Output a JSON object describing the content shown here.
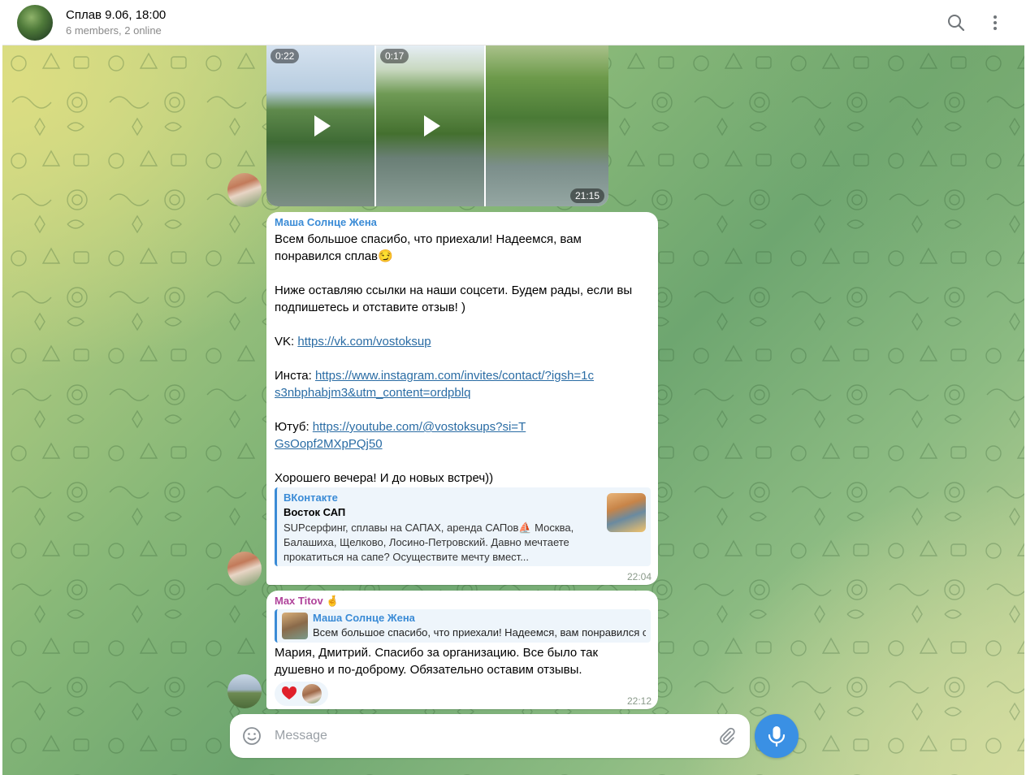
{
  "header": {
    "title": "Сплав 9.06, 18:00",
    "subtitle": "6 members, 2 online",
    "search_icon": "search-icon",
    "menu_icon": "more-vertical-icon"
  },
  "media_group": {
    "videos": [
      {
        "duration": "0:22"
      },
      {
        "duration": "0:17"
      }
    ],
    "time": "21:15"
  },
  "message1": {
    "sender": "Маша Солнце Жена",
    "sender_color": "#3a8bd6",
    "line1": "Всем большое спасибо, что приехали! Надеемся, вам понравился сплав😏",
    "line2": "Ниже оставляю ссылки на наши соцсети. Будем рады, если вы подпишетесь и отставите отзыв! )",
    "vk_label": "VK: ",
    "vk_link": "https://vk.com/vostoksup",
    "insta_label": "Инста: ",
    "insta_link": "https://www.instagram.com/invites/contact/?igsh=1cs3nbphabjm3&utm_content=ordpblq",
    "yt_label": "Ютуб: ",
    "yt_link": "https://youtube.com/@vostoksups?si=TGsOopf2MXpPQj50",
    "closing": "Хорошего вечера! И до новых встреч))",
    "preview": {
      "site": "ВКонтакте",
      "title": "Восток САП",
      "description": "SUPсерфинг, сплавы на САПАХ, аренда САПов⛵ Москва, Балашиха, Щелково, Лосино-Петровский.  Давно мечтаете прокатиться на сапе? Осуществите мечту вмест..."
    },
    "time": "22:04"
  },
  "message2": {
    "sender": "Max Titov 🤞",
    "sender_color": "#b0429a",
    "reply_name": "Маша Солнце Жена",
    "reply_text": "Всем большое спасибо, что приехали! Надеемся, вам понравился сплав😏",
    "text": "Мария, Дмитрий. Спасибо за организацию. Все было так душевно и по-доброму. Обязательно оставим отзывы.",
    "reaction": "❤️",
    "time": "22:12"
  },
  "composer": {
    "placeholder": "Message",
    "emoji_icon": "smile-icon",
    "attach_icon": "paperclip-icon",
    "mic_icon": "microphone-icon"
  },
  "colors": {
    "accent": "#3a90e4",
    "link": "#2a6ca4"
  }
}
